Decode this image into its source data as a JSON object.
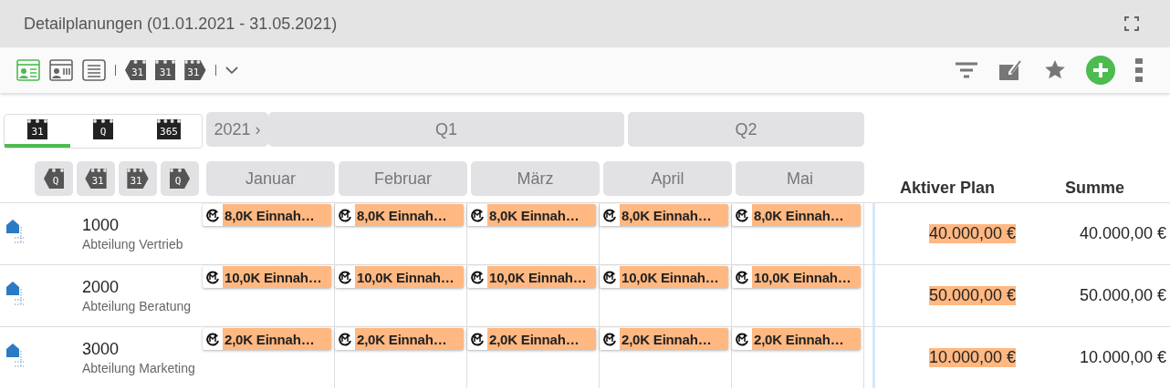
{
  "window": {
    "title": "Detailplanungen (01.01.2021 - 31.05.2021)"
  },
  "toolbar": {
    "views": [
      {
        "kind": "card",
        "selected": true
      },
      {
        "kind": "card-list",
        "selected": false
      },
      {
        "kind": "list",
        "selected": false
      }
    ],
    "periods": [
      {
        "kind": "prev",
        "label": "31"
      },
      {
        "kind": "current",
        "label": "31"
      },
      {
        "kind": "next",
        "label": "31"
      }
    ]
  },
  "scale_tabs": [
    {
      "label": "31",
      "selected": true
    },
    {
      "label": "Q",
      "selected": false
    },
    {
      "label": "365",
      "selected": false
    }
  ],
  "year": "2021 ›",
  "quarters": [
    {
      "label": "Q1",
      "months": [
        "Januar",
        "Februar",
        "März"
      ]
    },
    {
      "label": "Q2",
      "months": [
        "April",
        "Mai"
      ]
    }
  ],
  "nav_buttons": [
    {
      "kind": "prev",
      "label": "Q"
    },
    {
      "kind": "prev",
      "label": "31"
    },
    {
      "kind": "next",
      "label": "31"
    },
    {
      "kind": "next",
      "label": "Q"
    }
  ],
  "columns": [
    "Aktiver Plan",
    "Summe"
  ],
  "rows": [
    {
      "code": "1000",
      "name": "Abteilung Vertrieb",
      "cells": [
        "8,0K Einnah…",
        "8,0K Einnah…",
        "8,0K Einnah…",
        "8,0K Einnah…",
        "8,0K Einnah…"
      ],
      "active_plan": "40.000,00 €",
      "sum": "40.000,00 €"
    },
    {
      "code": "2000",
      "name": "Abteilung Beratung",
      "cells": [
        "10,0K Einnah…",
        "10,0K Einnah…",
        "10,0K Einnah…",
        "10,0K Einnah…",
        "10,0K Einnah…"
      ],
      "active_plan": "50.000,00 €",
      "sum": "50.000,00 €"
    },
    {
      "code": "3000",
      "name": "Abteilung Marketing",
      "cells": [
        "2,0K Einnah…",
        "2,0K Einnah…",
        "2,0K Einnah…",
        "2,0K Einnah…",
        "2,0K Einnah…"
      ],
      "active_plan": "10.000,00 €",
      "sum": "10.000,00 €"
    }
  ]
}
